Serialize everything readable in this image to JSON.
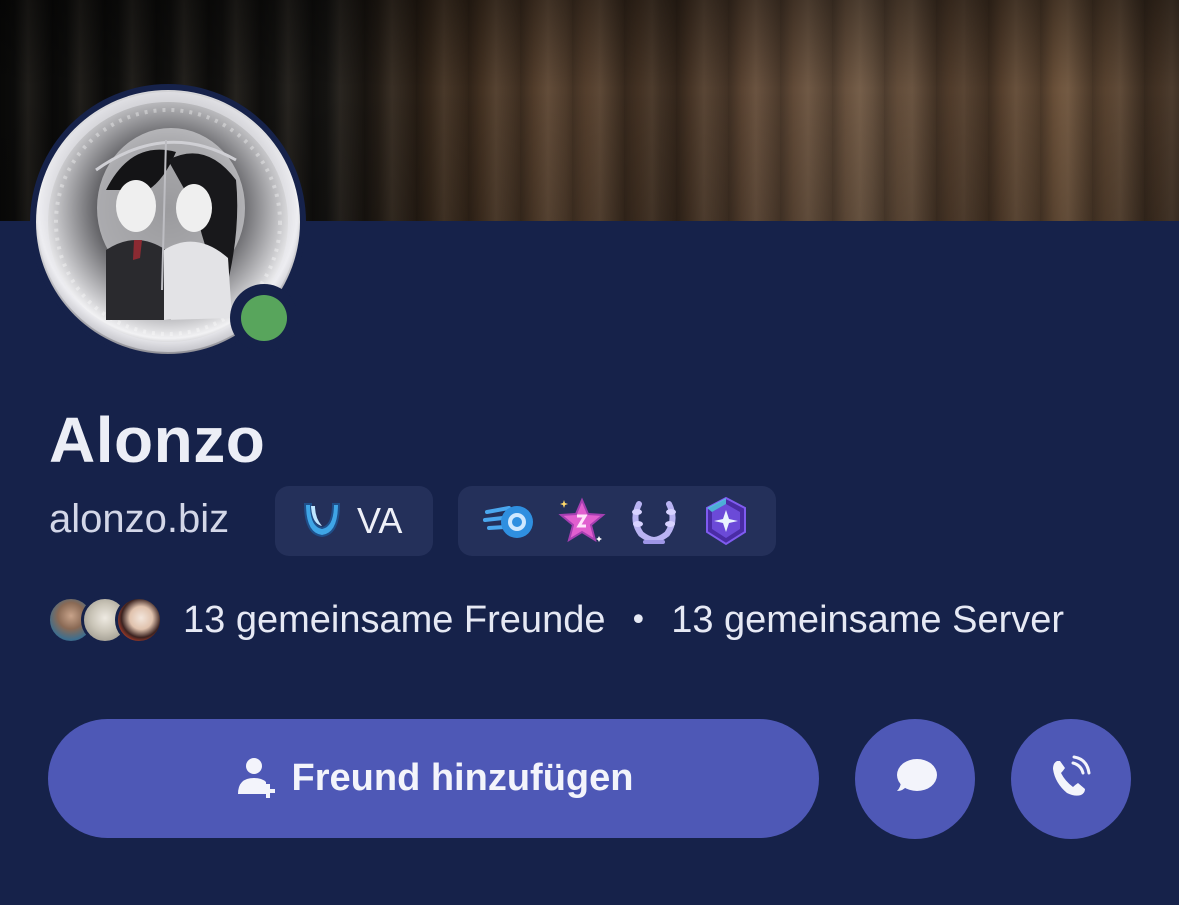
{
  "profile": {
    "display_name": "Alonzo",
    "username": "alonzo.biz",
    "status": "online",
    "tag": {
      "label": "VA",
      "icon": "crescent-badge-icon"
    }
  },
  "badges": [
    {
      "icon": "hypesquad-style-badge-icon"
    },
    {
      "icon": "star-quest-badge-icon"
    },
    {
      "icon": "laurel-badge-icon"
    },
    {
      "icon": "gem-nitro-badge-icon"
    }
  ],
  "mutuals": {
    "friends_text": "13 gemeinsame Freunde",
    "separator": "•",
    "servers_text": "13 gemeinsame Server"
  },
  "actions": {
    "add_friend_label": "Freund hinzufügen",
    "message_icon": "chat-bubble-icon",
    "call_icon": "phone-call-icon"
  },
  "colors": {
    "background": "#16224a",
    "pill": "#24305a",
    "accent": "#4e58b6",
    "status_online": "#58a55c"
  }
}
